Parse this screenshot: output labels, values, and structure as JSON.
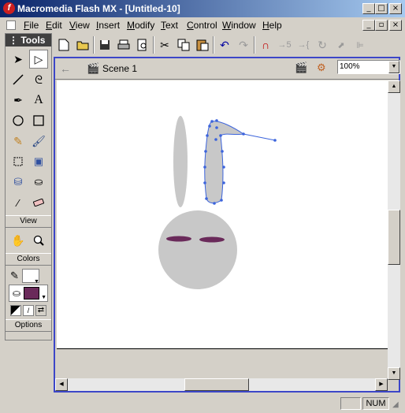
{
  "window": {
    "title": "Macromedia Flash MX - [Untitled-10]"
  },
  "menu": [
    "File",
    "Edit",
    "View",
    "Insert",
    "Modify",
    "Text",
    "Control",
    "Window",
    "Help"
  ],
  "tools_panel": {
    "title": "Tools",
    "view_label": "View",
    "colors_label": "Colors",
    "options_label": "Options"
  },
  "scene": {
    "label": "Scene 1"
  },
  "zoom": {
    "value": "100%"
  },
  "status": {
    "num": "NUM"
  },
  "colors": {
    "stroke": "#ffffff",
    "fill": "#6a2a5a",
    "accent": "#0a246a",
    "shape": "#c8c8c8",
    "eye": "#6a2a5a",
    "selection": "#3c64dc"
  }
}
